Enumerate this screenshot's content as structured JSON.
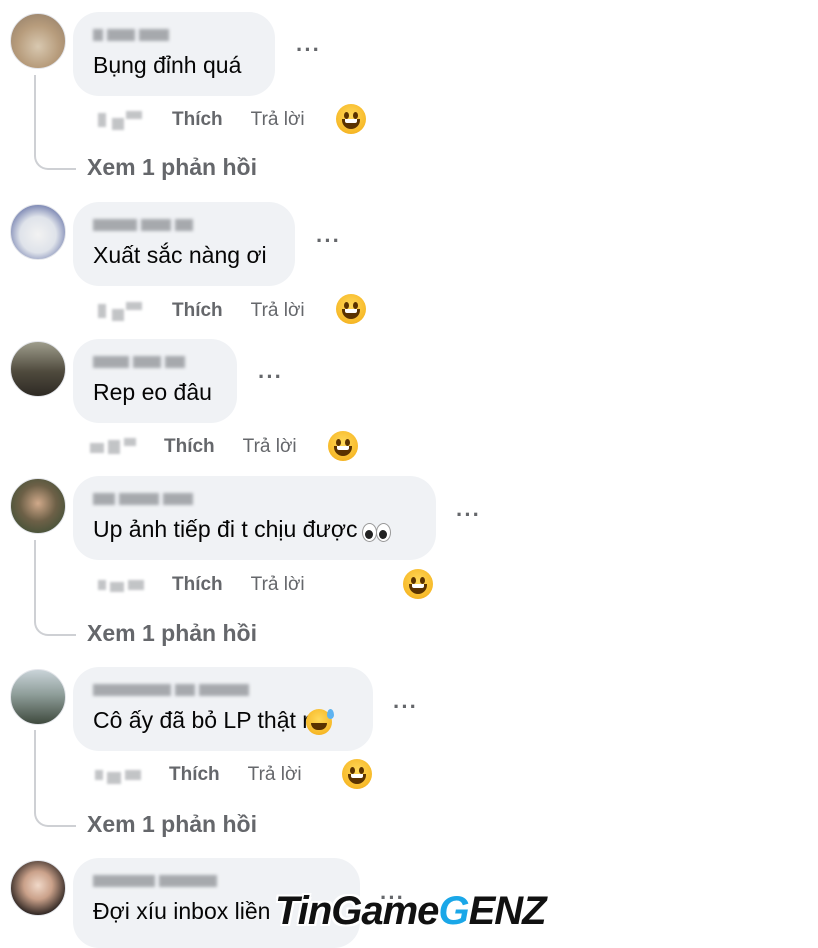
{
  "comments": [
    {
      "text": "Bụng đỉnh quá",
      "like": "Thích",
      "reply": "Trả lời",
      "view_replies": "Xem 1 phản hồi",
      "avatar": "cat-avatar"
    },
    {
      "text": "Xuất sắc nàng ơi",
      "like": "Thích",
      "reply": "Trả lời",
      "avatar": "white-cat-avatar"
    },
    {
      "text": "Rep eo đâu",
      "like": "Thích",
      "reply": "Trả lời",
      "avatar": "person-avatar"
    },
    {
      "text": "Up ảnh tiếp đi t chịu được",
      "like": "Thích",
      "reply": "Trả lời",
      "view_replies": "Xem 1 phản hồi",
      "avatar": "man-avatar",
      "trailing_emoji": "eyes-emoji"
    },
    {
      "text": "Cô ấy đã bỏ LP thật r",
      "like": "Thích",
      "reply": "Trả lời",
      "view_replies": "Xem 1 phản hồi",
      "avatar": "scene-avatar",
      "trailing_emoji": "sweat-smile-emoji"
    },
    {
      "text": "Đợi xíu inbox liền",
      "avatar": "girl-avatar"
    }
  ],
  "more_label": "···",
  "reaction_icon": "grinning-face-icon",
  "watermark": {
    "part1": "TinGame",
    "part2": "G",
    "part3": "ENZ",
    "brand_color": "#1aa7e8"
  }
}
